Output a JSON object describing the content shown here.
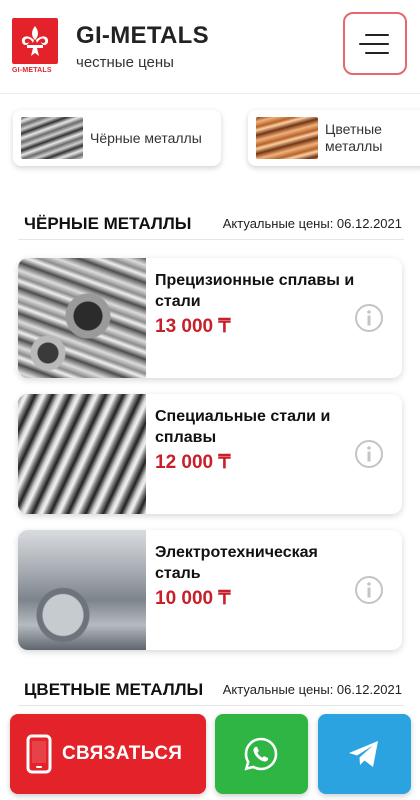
{
  "header": {
    "logo_caption": "GI-METALS",
    "brand_title": "GI-METALS",
    "brand_subtitle": "честные цены"
  },
  "categories": [
    {
      "label": "Чёрные металлы",
      "icon": "steel-pipes-thumbnail"
    },
    {
      "label": "Цветные металлы",
      "icon": "copper-pipes-thumbnail"
    }
  ],
  "sections": [
    {
      "title": "ЧЁРНЫЕ МЕТАЛЛЫ",
      "date": "Актуальные цены: 06.12.2021"
    },
    {
      "title": "ЦВЕТНЫЕ МЕТАЛЛЫ",
      "date": "Актуальные цены: 06.12.2021"
    }
  ],
  "products": [
    {
      "title": "Прецизионные сплавы и стали",
      "price": "13 000 ₸",
      "image": "steel-pipes-photo"
    },
    {
      "title": "Специальные стали и сплавы",
      "price": "12 000 ₸",
      "image": "profile-tubes-photo"
    },
    {
      "title": "Электротехническая сталь",
      "price": "10 000 ₸",
      "image": "steel-coils-photo"
    }
  ],
  "actions": {
    "contact_label": "СВЯЗАТЬСЯ",
    "whatsapp_icon": "whatsapp-icon",
    "telegram_icon": "telegram-icon"
  },
  "colors": {
    "brand_red": "#e3222a",
    "price_red": "#c8202a",
    "whatsapp_green": "#2fb543",
    "telegram_blue": "#2aa3e0"
  }
}
